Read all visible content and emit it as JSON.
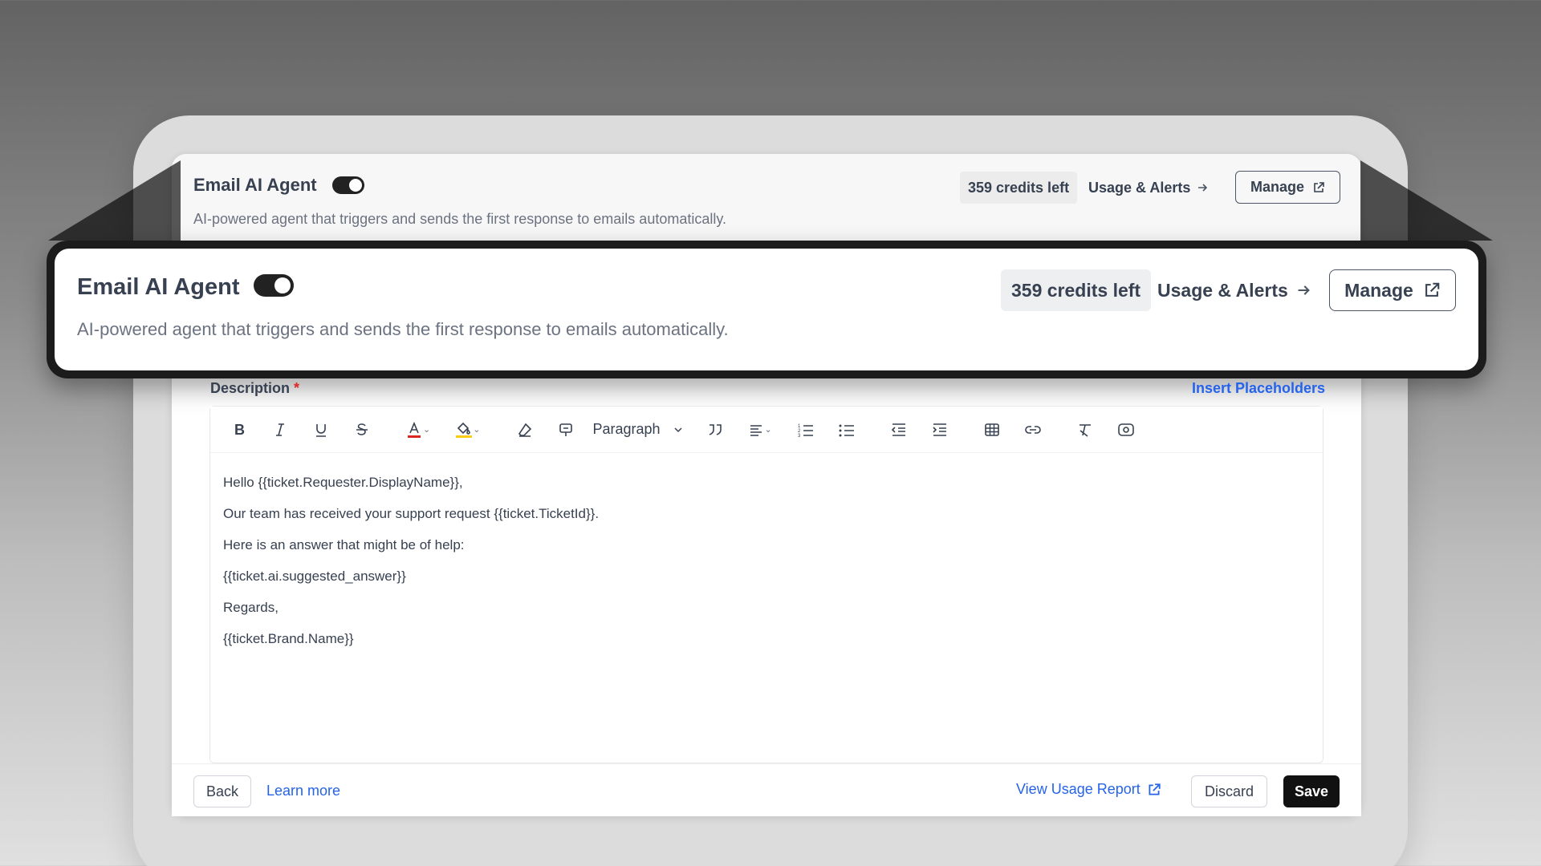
{
  "agent": {
    "title": "Email AI Agent",
    "description": "AI-powered agent that triggers and sends the first response to emails automatically.",
    "enabled": true
  },
  "header": {
    "credits_label": "359 credits left",
    "usage_label": "Usage & Alerts",
    "manage_label": "Manage"
  },
  "form": {
    "description_label": "Description",
    "required_marker": "*",
    "insert_placeholders_label": "Insert Placeholders"
  },
  "toolbar": {
    "paragraph_style": "Paragraph",
    "icons": [
      "bold-icon",
      "italic-icon",
      "underline-icon",
      "strikethrough-icon",
      "text-color-icon",
      "highlight-icon",
      "eraser-icon",
      "format-painter-icon",
      "blockquote-icon",
      "align-icon",
      "ordered-list-icon",
      "bullet-list-icon",
      "outdent-icon",
      "indent-icon",
      "table-icon",
      "link-icon",
      "clear-format-icon",
      "preview-icon"
    ]
  },
  "editor": {
    "lines": [
      "Hello  {{ticket.Requester.DisplayName}},",
      "Our team has received your support request {{ticket.TicketId}}.",
      "Here is an answer that might be of help:",
      "{{ticket.ai.suggested_answer}}",
      "Regards,",
      "{{ticket.Brand.Name}}"
    ]
  },
  "footer": {
    "back_label": "Back",
    "learn_more_label": "Learn more",
    "view_usage_label": "View Usage Report",
    "discard_label": "Discard",
    "save_label": "Save"
  },
  "colors": {
    "link": "#2563eb",
    "primary_button": "#111111",
    "required": "#dc2626",
    "text_color_underline": "#dc2626",
    "highlight_underline": "#facc15"
  }
}
